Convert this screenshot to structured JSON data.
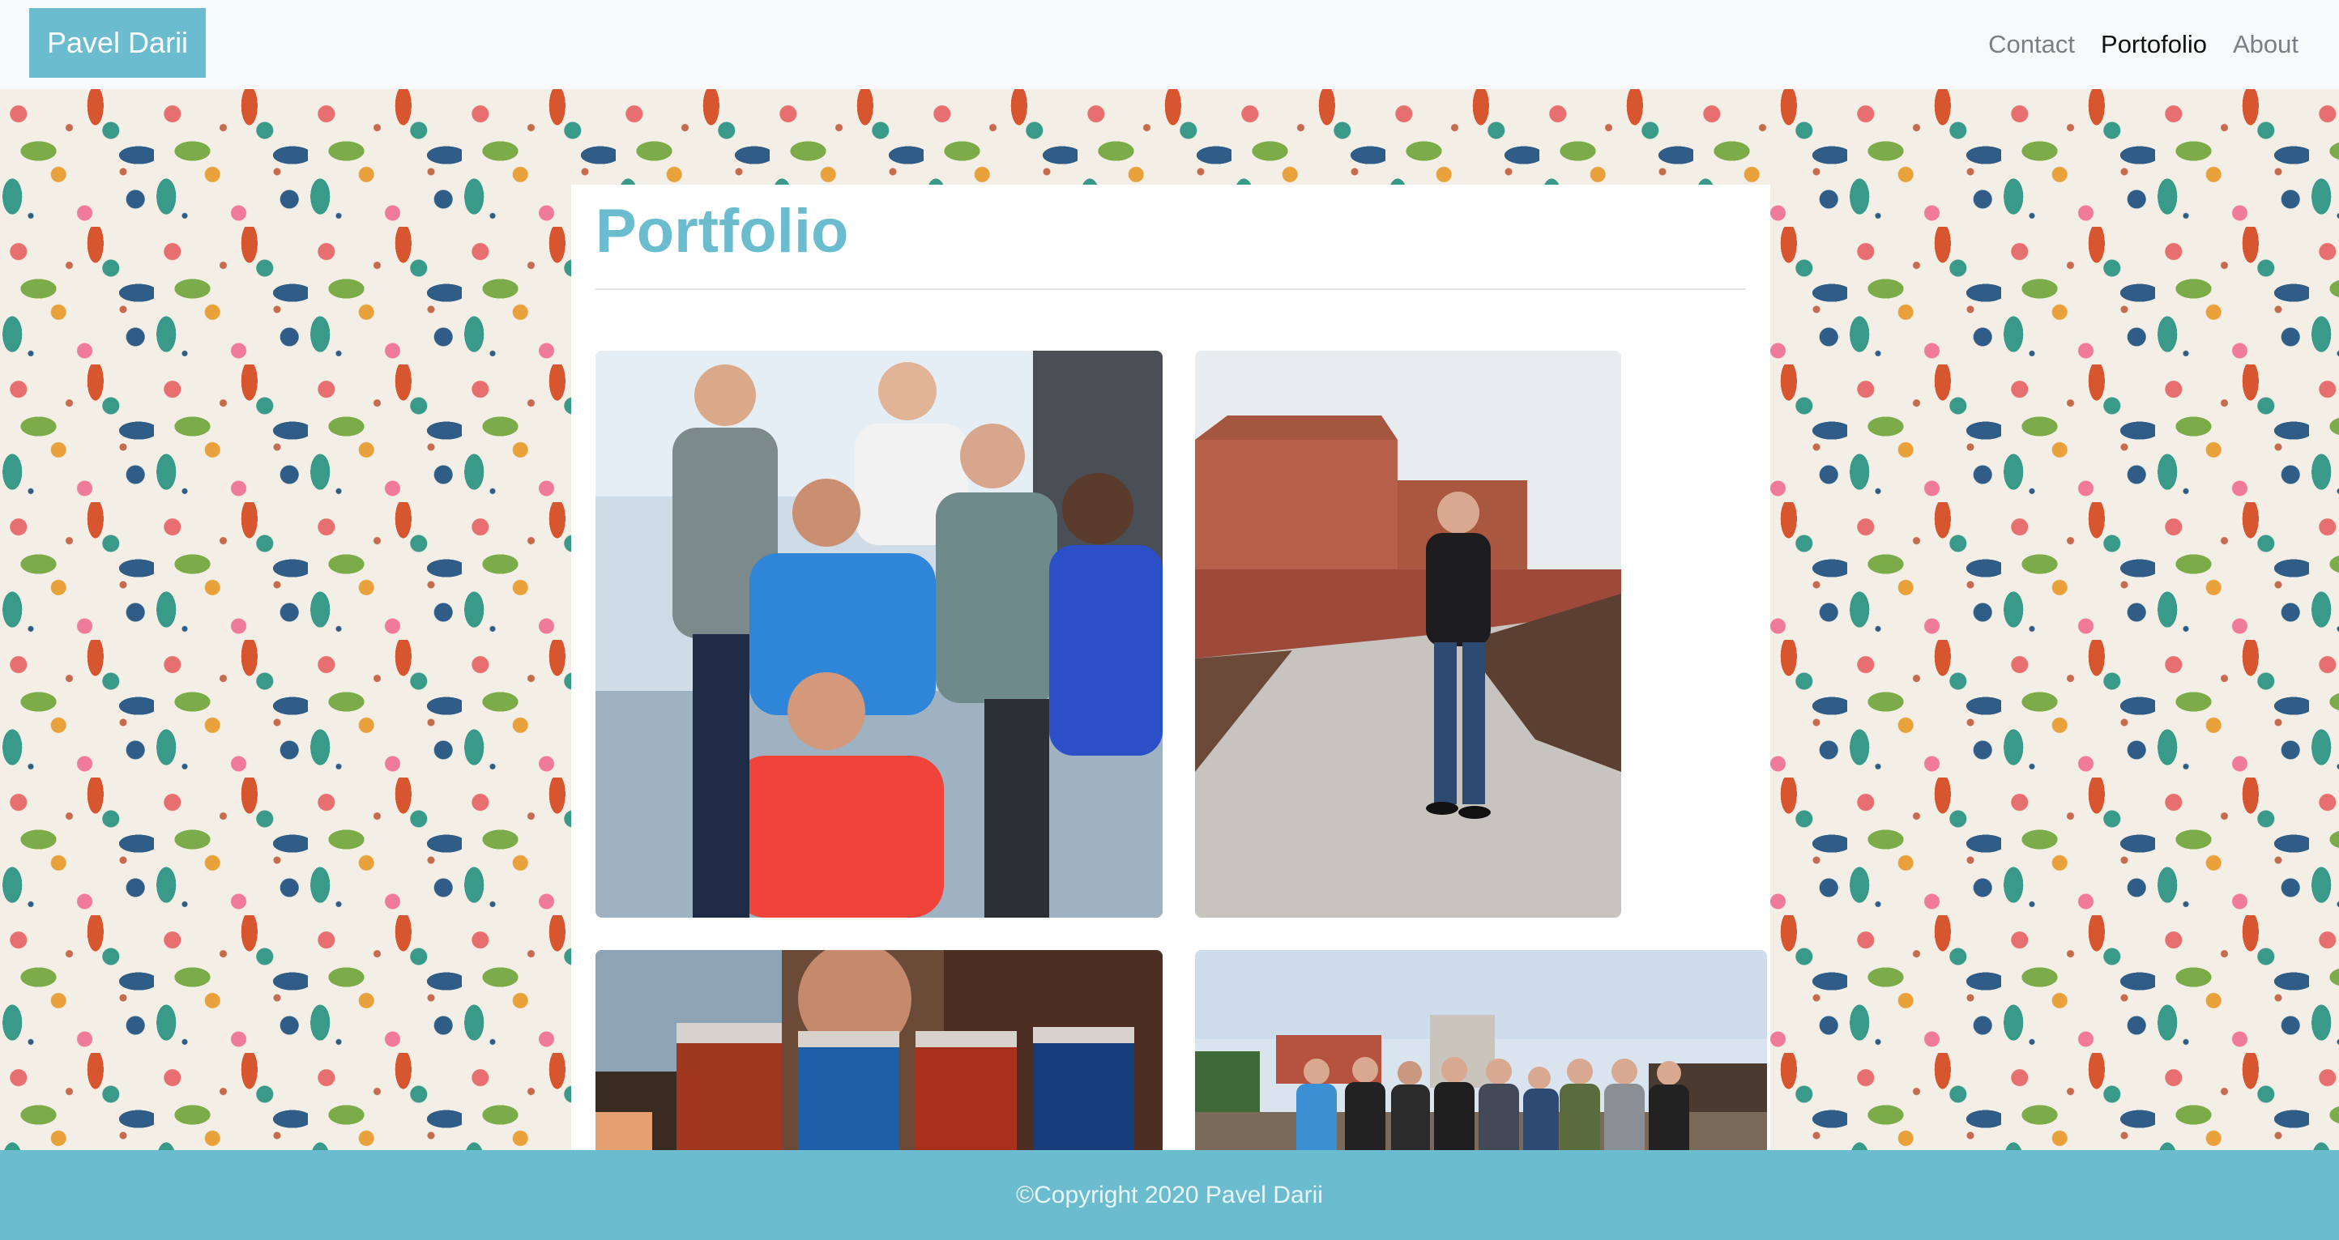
{
  "navbar": {
    "brand": "Pavel Darii",
    "links": [
      {
        "label": "Contact",
        "active": false
      },
      {
        "label": "Portofolio",
        "active": true
      },
      {
        "label": "About",
        "active": false
      }
    ]
  },
  "main": {
    "title": "Portfolio",
    "photos": [
      {
        "subject": "group-of-six-people-indoors"
      },
      {
        "subject": "man-standing-on-path-by-brick-walls"
      },
      {
        "subject": "row-of-colored-shot-glasses"
      },
      {
        "subject": "group-of-people-outdoors"
      }
    ]
  },
  "footer": {
    "copyright": "©Copyright 2020 Pavel Darii"
  },
  "colors": {
    "accent": "#6cbccf",
    "navbar_bg": "#f8f9fa",
    "pattern_bg": "#f4efe6",
    "active_link": "#111111",
    "inactive_link": "#7a7f85"
  }
}
